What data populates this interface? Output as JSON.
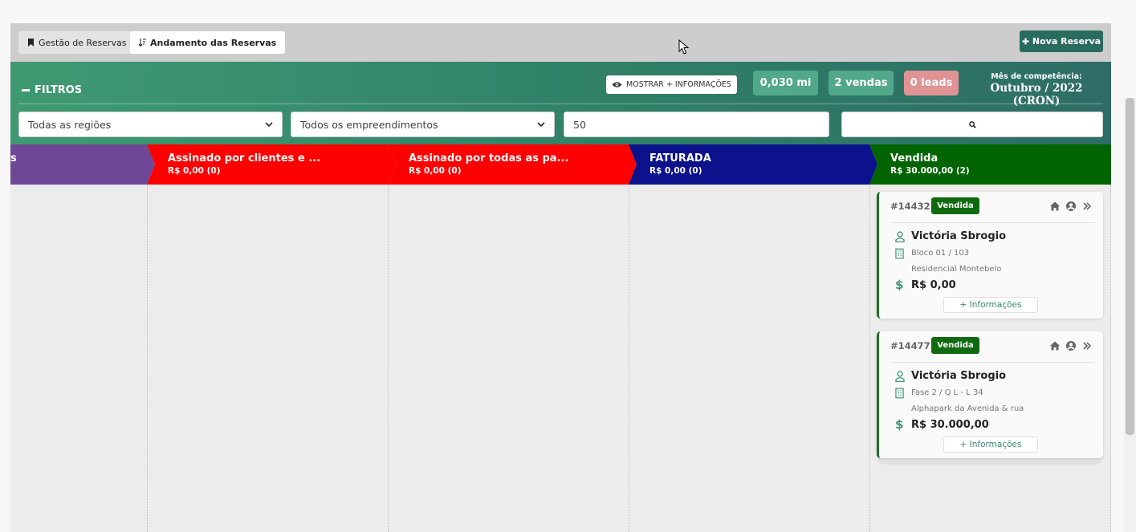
{
  "tabs": [
    {
      "label": "Gestão de Reservas",
      "icon": "bookmark-icon"
    },
    {
      "label": "Andamento das Reservas",
      "icon": "sort-icon"
    }
  ],
  "nova_reserva": {
    "label": "Nova Reserva",
    "icon": "plus-icon"
  },
  "filters": {
    "title": "FILTROS",
    "mostrar_label": "MOSTRAR + INFORMAÇÕES",
    "stats": {
      "mi": "0,030 mi",
      "vendas": "2 vendas",
      "leads": "0 leads"
    },
    "mes_label": "Mês de competência:",
    "mes_value": "Outubro / 2022 (CRON)",
    "regioes": "Todas as regiões",
    "empreendimentos": "Todos os empreendimentos",
    "quantidade": "50"
  },
  "stages": [
    {
      "title": "s",
      "sub": "",
      "color": "#6f4797"
    },
    {
      "title": "Assinado por clientes e ...",
      "sub": "R$ 0,00 (0)",
      "color": "#ff0000"
    },
    {
      "title": "Assinado por todas as pa...",
      "sub": "R$ 0,00 (0)",
      "color": "#ff0000"
    },
    {
      "title": "FATURADA",
      "sub": "R$ 0,00 (0)",
      "color": "#0c118c"
    },
    {
      "title": "Vendida",
      "sub": "R$ 30.000,00 (2)",
      "color": "#006400"
    }
  ],
  "cards": [
    {
      "id": "#14432",
      "status": "Vendida",
      "name": "Victória Sbrogio",
      "unit": "Bloco 01 / 103",
      "project": "Residencial Montebelo",
      "value": "R$ 0,00",
      "info": "+ Informações"
    },
    {
      "id": "#14477",
      "status": "Vendida",
      "name": "Victória Sbrogio",
      "unit": "Fase 2 / Q L - L 34",
      "project": "Alphapark da Avenida & rua",
      "value": "R$ 30.000,00",
      "info": "+ Informações"
    }
  ],
  "colors": {
    "accent": "#2a6b5f",
    "badge": "#0f6a0f",
    "leads": "#e09294"
  }
}
